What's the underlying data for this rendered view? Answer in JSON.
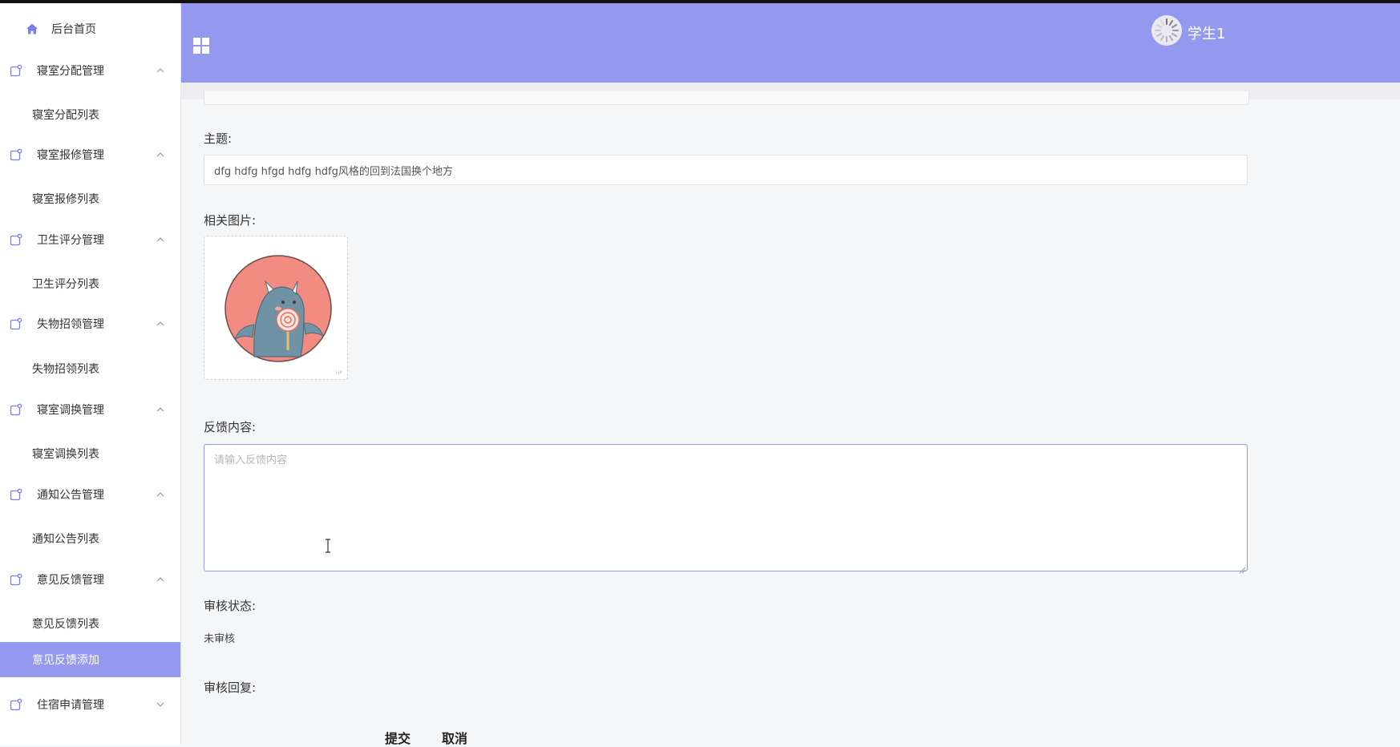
{
  "sidebar": {
    "home": "后台首页",
    "groups": [
      {
        "label": "寝室分配管理",
        "sub": "寝室分配列表"
      },
      {
        "label": "寝室报修管理",
        "sub": "寝室报修列表"
      },
      {
        "label": "卫生评分管理",
        "sub": "卫生评分列表"
      },
      {
        "label": "失物招领管理",
        "sub": "失物招领列表"
      },
      {
        "label": "寝室调换管理",
        "sub": "寝室调换列表"
      },
      {
        "label": "通知公告管理",
        "sub": "通知公告列表"
      },
      {
        "label": "意见反馈管理",
        "sub": "意见反馈列表"
      }
    ],
    "active_item": "意见反馈添加",
    "last_group": "住宿申请管理",
    "icons": {
      "home": "home-icon",
      "group": "folder-edit-icon",
      "expanded": "chevron-up-icon",
      "collapsed": "chevron-down-icon"
    }
  },
  "header": {
    "username": "学生1",
    "menu_icon": "grid-menu-icon",
    "avatar": "avatar-image"
  },
  "form": {
    "subject_label": "主题:",
    "subject_value": "dfg hdfg hfgd hdfg hdfg风格的回到法国换个地方",
    "image_label": "相关图片:",
    "feedback_label": "反馈内容:",
    "feedback_placeholder": "请输入反馈内容",
    "review_status_label": "审核状态:",
    "review_status_value": "未审核",
    "review_reply_label": "审核回复:",
    "submit_label": "提交",
    "cancel_label": "取消"
  },
  "colors": {
    "accent": "#9499ef",
    "background": "#f5f6f8"
  }
}
